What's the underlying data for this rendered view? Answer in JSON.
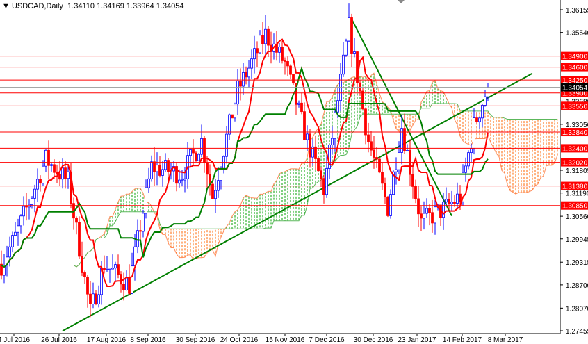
{
  "header": {
    "symbol": "USDCAD,Daily",
    "open": "1.34110",
    "high": "1.34169",
    "low": "1.33964",
    "close": "1.34054",
    "menu_icon": "triangle-down-icon"
  },
  "colors": {
    "bull": "#0000ff",
    "bear": "#ff0000",
    "tenkan": "#ff0000",
    "kijun": "#008000",
    "cloud_up": "#00a000",
    "cloud_down": "#ff6600",
    "level": "#ff0000",
    "trend": "#008000"
  },
  "chart_data": {
    "type": "candlestick",
    "title": "USDCAD,Daily",
    "ylim": [
      1.27455,
      1.36155
    ],
    "y_ticks": [
      "1.36155",
      "1.35540",
      "1.33680",
      "1.33050",
      "1.31805",
      "1.31190",
      "1.30560",
      "1.29945",
      "1.29315",
      "1.28700",
      "1.28070",
      "1.27455"
    ],
    "x_ticks": [
      "4 Jul 2016",
      "26 Jul 2016",
      "17 Aug 2016",
      "8 Sep 2016",
      "30 Sep 2016",
      "24 Oct 2016",
      "15 Nov 2016",
      "7 Dec 2016",
      "30 Dec 2016",
      "23 Jan 2017",
      "14 Feb 2017",
      "8 Mar 2017"
    ],
    "levels": [
      "1.34900",
      "1.34600",
      "1.34250",
      "1.33900",
      "1.33550",
      "1.32840",
      "1.32400",
      "1.32020",
      "1.31380",
      "1.30850"
    ],
    "current_price": "1.34054",
    "approx_close_path": [
      [
        0,
        1.2926
      ],
      [
        5,
        1.3
      ],
      [
        16,
        1.321
      ],
      [
        24,
        1.315
      ],
      [
        32,
        1.2795
      ],
      [
        37,
        1.2926
      ],
      [
        46,
        1.287
      ],
      [
        54,
        1.319
      ],
      [
        65,
        1.317
      ],
      [
        72,
        1.326
      ],
      [
        76,
        1.311
      ],
      [
        85,
        1.3397
      ],
      [
        95,
        1.3548
      ],
      [
        102,
        1.347
      ],
      [
        110,
        1.326
      ],
      [
        116,
        1.313
      ],
      [
        120,
        1.332
      ],
      [
        125,
        1.3567
      ],
      [
        132,
        1.326
      ],
      [
        139,
        1.308
      ],
      [
        144,
        1.33
      ],
      [
        151,
        1.304
      ],
      [
        160,
        1.308
      ],
      [
        165,
        1.311
      ],
      [
        170,
        1.33
      ],
      [
        175,
        1.3407
      ]
    ],
    "indicators": [
      "Ichimoku Kinko Hyo (Tenkan, Kijun, Kumo)"
    ],
    "trendlines": [
      [
        [
          22,
          1.2745
        ],
        [
          191,
          1.3443
        ]
      ],
      [
        [
          126,
          1.359
        ],
        [
          162,
          1.3057
        ]
      ]
    ]
  }
}
